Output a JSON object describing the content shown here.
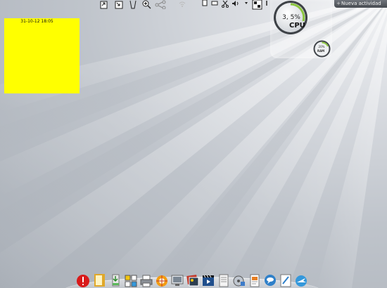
{
  "desktop": {
    "background": "#c4c8ce",
    "accent": "#ffff00"
  },
  "top_toolbar": {
    "icons": [
      "paste-icon",
      "frame-icon",
      "trash-icon",
      "zoom-in-icon",
      "share-icon",
      "network-icon",
      "clipboard-icon",
      "display-icon",
      "cut-icon",
      "volume-icon",
      "workspace-icon",
      "info-icon"
    ]
  },
  "activity": {
    "new_label": "Nueva actividad"
  },
  "sticky_note": {
    "date": "31-10-12 18:05",
    "color": "#ffff00"
  },
  "cpu_widget": {
    "value": "3, 5%",
    "label": "CPU",
    "load_percent": 3.5,
    "arc_color": "#8cc63f"
  },
  "ram_widget": {
    "value": "20%",
    "label": "RAM"
  },
  "dock": {
    "icons": [
      "logout-icon",
      "notes-icon",
      "installer-icon",
      "settings-icon",
      "printer-icon",
      "network-settings-icon",
      "screenshot-icon",
      "photo-viewer-icon",
      "video-player-icon",
      "file-manager-icon",
      "disk-tool-icon",
      "document-editor-icon",
      "chat-icon",
      "text-editor-icon",
      "web-browser-icon"
    ]
  }
}
